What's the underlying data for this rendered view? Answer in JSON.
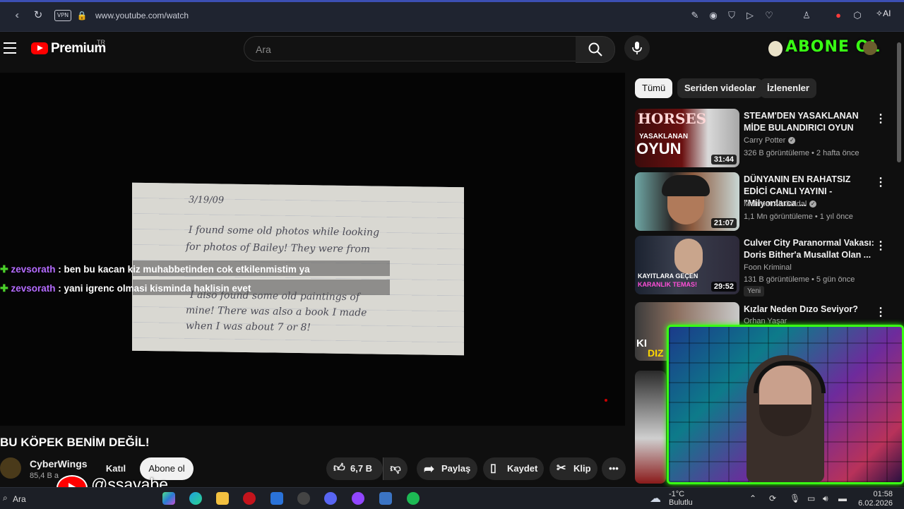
{
  "browser": {
    "url": "www.youtube.com/watch",
    "vpn_label": "VPN",
    "ai_label": "AI"
  },
  "header": {
    "logo_text": "Premium",
    "region": "TR",
    "search_placeholder": "Ara",
    "overlay_subscribe_text": "ABONE OL"
  },
  "video": {
    "note_lines": [
      "3/19/09",
      "I found some old photos while looking",
      "for photos of Bailey! They were from",
      "I also found some old paintings of",
      "mine! There was also a book I made",
      "when I was about 7 or 8!"
    ],
    "chat": [
      {
        "user": "zevsorath",
        "message": ": ben bu kacan kiz muhabbetinden cok etkilenmistim ya"
      },
      {
        "user": "zevsorath",
        "message": ": yani igrenc olmasi kisminda haklisin evet"
      }
    ]
  },
  "watch": {
    "title": "BU KÖPEK BENİM DEĞİL!",
    "channel_name": "CyberWings",
    "subscribers": "85,4 B a",
    "join_label": "Katıl",
    "subscribe_label": "Abone ol",
    "like_count": "6,7 B",
    "share_label": "Paylaş",
    "save_label": "Kaydet",
    "clip_label": "Klip",
    "overlay_handle": "@ssayabe"
  },
  "sidebar": {
    "chips": [
      "Tümü",
      "Seriden videolar",
      "İzlenenler"
    ],
    "recs": [
      {
        "title": "STEAM'DEN YASAKLANAN MİDE BULANDIRICI OYUN",
        "channel": "Carry Potter",
        "meta": "326 B görüntüleme • 2 hafta önce",
        "duration": "31:44",
        "thumb_text1": "HORSES",
        "thumb_text2": "YASAKLANAN",
        "thumb_text3": "OYUN"
      },
      {
        "title": "DÜNYANIN EN RAHATSIZ EDİCİ CANLI YAYINI - \"Milyonlarca ...",
        "channel": "Mehmet Ali Güldal",
        "meta": "1,1 Mn görüntüleme • 1 yıl önce",
        "duration": "21:07"
      },
      {
        "title": "Culver City Paranormal Vakası: Doris Bither'a Musallat Olan ...",
        "channel": "Foon Kriminal",
        "meta": "131 B görüntüleme • 5 gün önce",
        "duration": "29:52",
        "badge": "Yeni",
        "thumb_text1": "KAYITLARA GEÇEN",
        "thumb_text2": "KARANLIK TEMAS!"
      },
      {
        "title": "Kızlar Neden Dızo Seviyor?",
        "channel": "Orhan Yaşar",
        "thumb_text1": "KI",
        "thumb_text2": "DIZ"
      }
    ]
  },
  "taskbar": {
    "search_label": "Ara",
    "temp": "-1°C",
    "weather": "Bulutlu",
    "time": "01:58",
    "date": "6.02.2026"
  }
}
